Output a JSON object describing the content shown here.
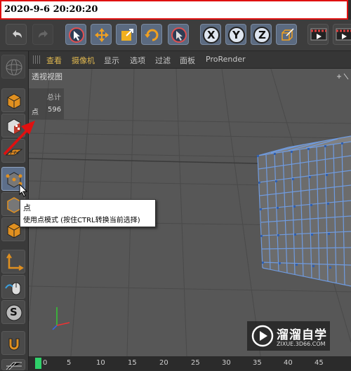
{
  "stamp": {
    "text": "2020-9-6 20:20:20"
  },
  "toolbar": {
    "buttons": [
      "undo-icon",
      "redo-icon",
      "live-select-icon",
      "move-icon",
      "scale-icon",
      "rotate-icon",
      "select-icon",
      "x-axis-icon",
      "y-axis-icon",
      "z-axis-icon",
      "coord-system-icon",
      "render-view-icon",
      "render-icon"
    ],
    "axis_x": "X",
    "axis_y": "Y",
    "axis_z": "Z"
  },
  "viewport_menu": {
    "items": [
      "查看",
      "摄像机",
      "显示",
      "选项",
      "过滤",
      "面板",
      "ProRender"
    ]
  },
  "viewport": {
    "title": "透视视图",
    "hud_header": "总计",
    "hud_label": "点",
    "hud_value": "596"
  },
  "tooltip": {
    "title": "点",
    "description": "使用点模式 (按住CTRL转换当前选择)"
  },
  "timeline": {
    "marks": [
      "0",
      "5",
      "10",
      "15",
      "20",
      "25",
      "30",
      "35",
      "40",
      "45"
    ]
  },
  "watermark": {
    "name": "溜溜自学",
    "url": "ZIXUE.3D66.COM"
  },
  "colors": {
    "accent": "#e01010",
    "cube_edges": "#6f9be0",
    "timeline_cursor": "#2fd06a"
  }
}
